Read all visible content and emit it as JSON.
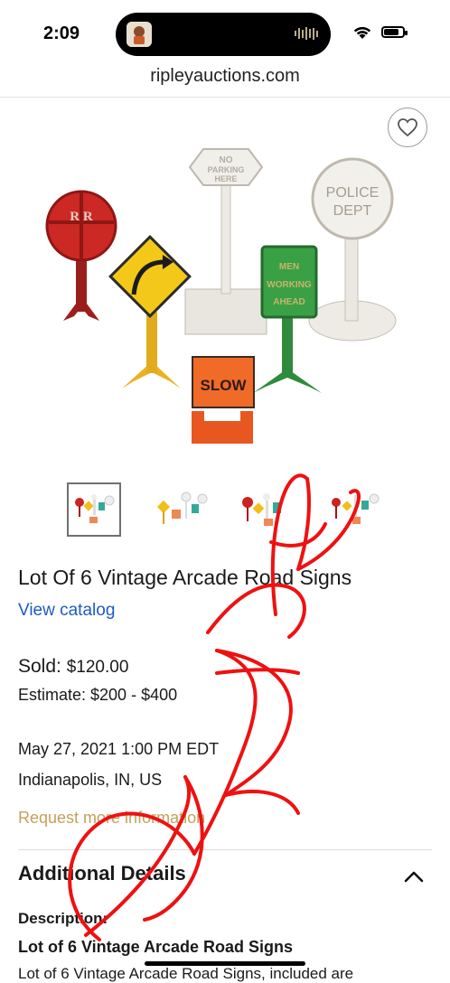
{
  "status": {
    "time": "2:09",
    "battery_level": 0.8
  },
  "browser": {
    "url": "ripleyauctions.com"
  },
  "hero": {
    "sign_rr": "R R",
    "sign_slow": "SLOW",
    "sign_no_parking": [
      "NO",
      "PARKING",
      "HERE"
    ],
    "sign_men_working": [
      "MEN",
      "WORKING",
      "AHEAD"
    ],
    "sign_police": [
      "POLICE",
      "DEPT"
    ]
  },
  "thumbnails": [
    {
      "active": true
    },
    {
      "active": false
    },
    {
      "active": false
    },
    {
      "active": false
    }
  ],
  "lot": {
    "title": "Lot Of 6 Vintage Arcade Road Signs",
    "view_catalog": "View catalog",
    "sold_label": "Sold:",
    "sold_value": "$120.00",
    "estimate": "Estimate: $200 - $400",
    "date": "May 27, 2021 1:00 PM EDT",
    "location": "Indianapolis, IN, US",
    "request_info": "Request more information"
  },
  "details": {
    "section_title": "Additional Details",
    "description_label": "Description:",
    "description_heading": "Lot of 6 Vintage Arcade Road Signs",
    "description_text": "Lot of 6 Vintage Arcade Road Signs, included are"
  },
  "colors": {
    "link": "#1e5bc6",
    "request": "#c4a15a",
    "scribble": "#ee1111"
  }
}
